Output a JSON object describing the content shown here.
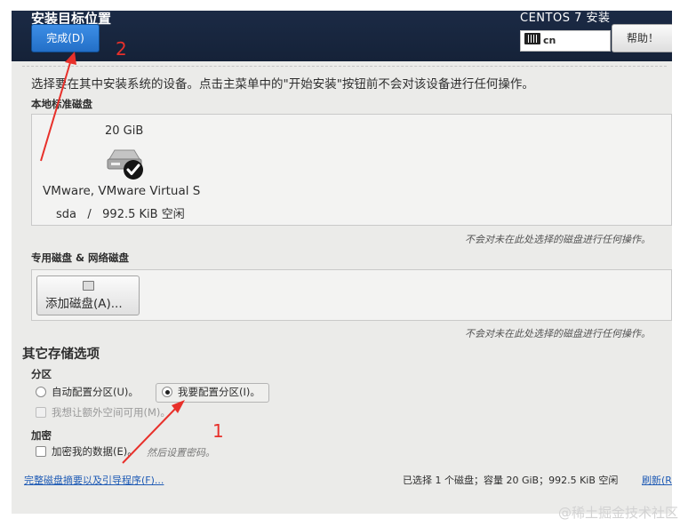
{
  "header": {
    "title": "安装目标位置",
    "done_label": "完成(D)",
    "product": "CENTOS 7 安装",
    "keyboard_layout": "cn",
    "help_label": "帮助！"
  },
  "instruction": "选择要在其中安装系统的设备。点击主菜单中的\"开始安装\"按钮前不会对该设备进行任何操作。",
  "local_disks": {
    "heading": "本地标准磁盘",
    "disk": {
      "size": "20 GiB",
      "name": "VMware, VMware Virtual S",
      "free": "sda   /   992.5 KiB 空闲",
      "selected": true
    },
    "note": "不会对未在此处选择的磁盘进行任何操作。"
  },
  "specialized_disks": {
    "heading": "专用磁盘 & 网络磁盘",
    "add_label": "添加磁盘(A)...",
    "note": "不会对未在此处选择的磁盘进行任何操作。"
  },
  "other_storage": {
    "heading": "其它存储选项",
    "partition_heading": "分区",
    "auto_label": "自动配置分区(U)。",
    "manual_label": "我要配置分区(I)。",
    "extra_space_label": "我想让额外空间可用(M)。",
    "encrypt_heading": "加密",
    "encrypt_label": "加密我的数据(E)。",
    "encrypt_hint": "然后设置密码。"
  },
  "footer": {
    "summary_link": "完整磁盘摘要以及引导程序(F)...",
    "status": "已选择 1 个磁盘；容量 20 GiB；992.5 KiB 空闲",
    "refresh_label": "刷新(R"
  },
  "annotations": {
    "step1": "1",
    "step2": "2",
    "color": "#e8302a"
  },
  "watermark": "@稀土掘金技术社区"
}
